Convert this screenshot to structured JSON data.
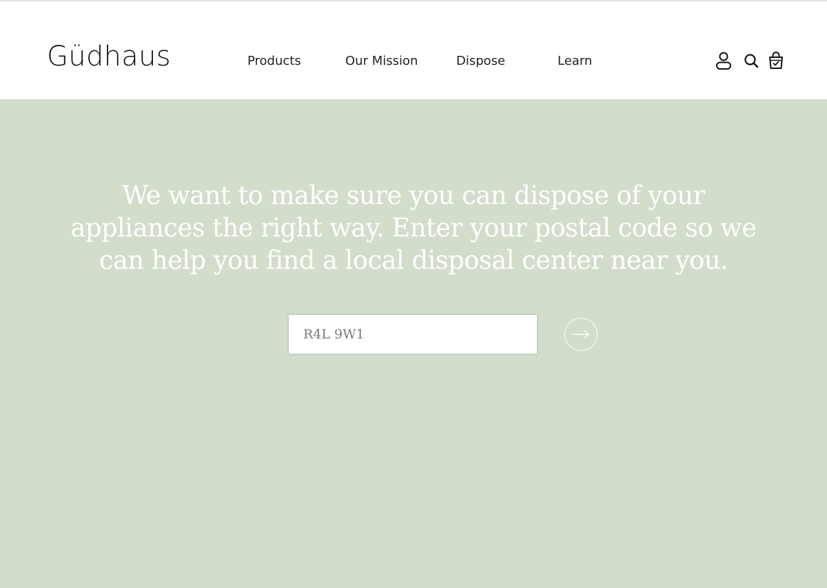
{
  "header": {
    "logo": "Güdhaus",
    "nav": {
      "products": "Products",
      "mission": "Our Mission",
      "dispose": "Dispose",
      "learn": "Learn"
    },
    "icons": [
      "account-icon",
      "search-icon",
      "shopping-bag-icon"
    ]
  },
  "hero": {
    "message": "We want to make sure you can dispose of your appliances the right way. Enter your postal code so we can help you find a local disposal center near you.",
    "postal_input": {
      "value": "R4L 9W1",
      "placeholder": ""
    },
    "submit_icon": "arrow-right-icon"
  },
  "colors": {
    "hero_background": "#d2ddcb",
    "header_background": "#ffffff",
    "text_dark": "#222222",
    "text_light": "#ffffff"
  }
}
